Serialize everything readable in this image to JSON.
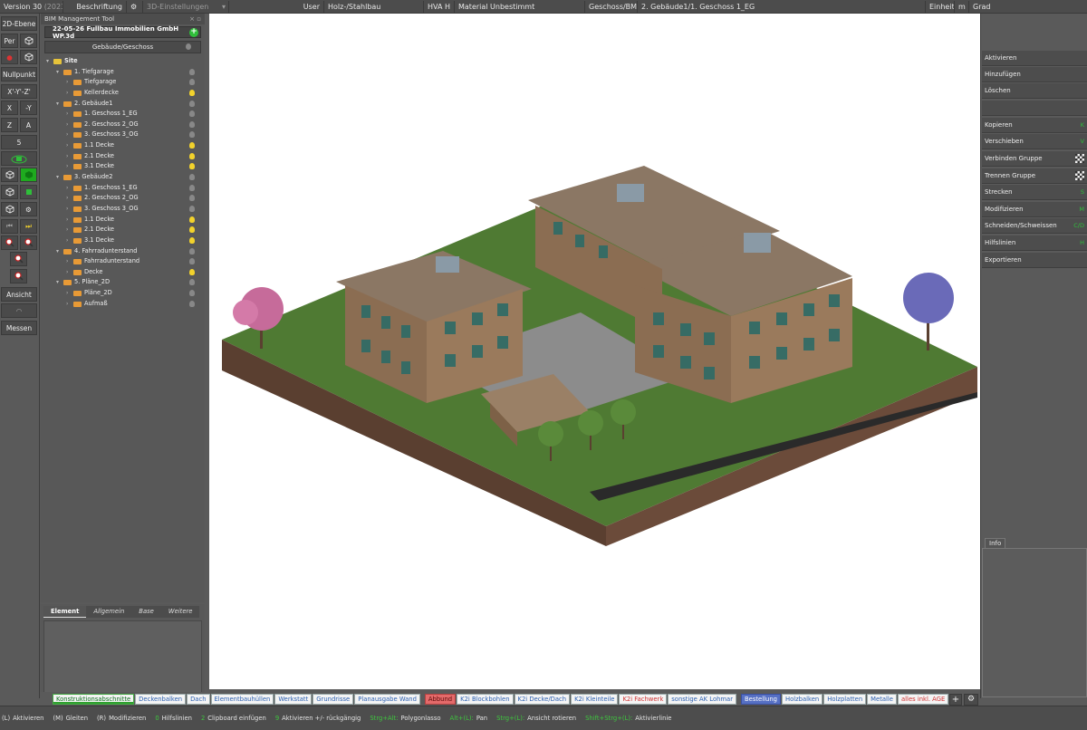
{
  "topbar": {
    "version": "Version 30",
    "version_year": "(2023)",
    "beschriftung": "Beschriftung",
    "einstellungen": "3D-Einstellungen",
    "user_label": "User",
    "user_value": "Holz-/Stahlbau",
    "hva": "HVA",
    "h": "H",
    "material_label": "Material",
    "material_value": "Unbestimmt",
    "geschoss_label": "Geschoss/BMT",
    "geschoss_value": "2. Gebäude1/1. Geschoss 1_EG",
    "einheit": "Einheit",
    "unit_m": "m",
    "unit_grad": "Grad"
  },
  "toolbar": {
    "ebene_2d": "2D-Ebene",
    "per": "Per",
    "nullpunkt": "Nullpunkt",
    "xyz": "X'-Y'-Z'",
    "x": "X",
    "neg_y": "-Y",
    "z": "Z",
    "a": "A",
    "five": "5",
    "ansicht": "Ansicht",
    "messen": "Messen"
  },
  "bim": {
    "title": "BIM Management Tool",
    "file": "22-05-26 Fullbau Immobilien GmbH WP.3d",
    "sub": "Gebäude/Geschoss",
    "tree": [
      {
        "label": "Site",
        "level": 0,
        "type": "site",
        "bulb": ""
      },
      {
        "label": "1. Tiefgarage",
        "level": 1,
        "type": "group",
        "bulb": "off"
      },
      {
        "label": "Tiefgarage",
        "level": 2,
        "type": "item",
        "bulb": "off"
      },
      {
        "label": "Kellerdecke",
        "level": 2,
        "type": "item",
        "bulb": "on"
      },
      {
        "label": "2. Gebäude1",
        "level": 1,
        "type": "group",
        "bulb": "off"
      },
      {
        "label": "1. Geschoss 1_EG",
        "level": 2,
        "type": "item",
        "bulb": "off"
      },
      {
        "label": "2. Geschoss 2_OG",
        "level": 2,
        "type": "item",
        "bulb": "off"
      },
      {
        "label": "3. Geschoss 3_OG",
        "level": 2,
        "type": "item",
        "bulb": "off"
      },
      {
        "label": "1.1 Decke",
        "level": 2,
        "type": "item",
        "bulb": "on"
      },
      {
        "label": "2.1 Decke",
        "level": 2,
        "type": "item",
        "bulb": "on"
      },
      {
        "label": "3.1 Decke",
        "level": 2,
        "type": "item",
        "bulb": "on"
      },
      {
        "label": "3. Gebäude2",
        "level": 1,
        "type": "group",
        "bulb": "off"
      },
      {
        "label": "1. Geschoss 1_EG",
        "level": 2,
        "type": "item",
        "bulb": "off"
      },
      {
        "label": "2. Geschoss 2_OG",
        "level": 2,
        "type": "item",
        "bulb": "off"
      },
      {
        "label": "3. Geschoss 3_OG",
        "level": 2,
        "type": "item",
        "bulb": "off"
      },
      {
        "label": "1.1 Decke",
        "level": 2,
        "type": "item",
        "bulb": "on"
      },
      {
        "label": "2.1 Decke",
        "level": 2,
        "type": "item",
        "bulb": "on"
      },
      {
        "label": "3.1 Decke",
        "level": 2,
        "type": "item",
        "bulb": "on"
      },
      {
        "label": "4. Fahrradunterstand",
        "level": 1,
        "type": "group",
        "bulb": "off"
      },
      {
        "label": "Fahrradunterstand",
        "level": 2,
        "type": "item",
        "bulb": "off"
      },
      {
        "label": "Decke",
        "level": 2,
        "type": "item",
        "bulb": "on"
      },
      {
        "label": "5. Pläne_2D",
        "level": 1,
        "type": "group",
        "bulb": "off"
      },
      {
        "label": "Pläne_2D",
        "level": 2,
        "type": "item",
        "bulb": "off"
      },
      {
        "label": "Aufmaß",
        "level": 2,
        "type": "item",
        "bulb": "off"
      }
    ]
  },
  "element_tabs": [
    "Element",
    "Allgemein",
    "Base",
    "Weitere"
  ],
  "right_panel": {
    "aktivieren": "Aktivieren",
    "hinzufuegen": "Hinzufügen",
    "loeschen": "Löschen",
    "kopieren": "Kopieren",
    "verschieben": "Verschieben",
    "verbinden": "Verbinden Gruppe",
    "trennen": "Trennen Gruppe",
    "strecken": "Strecken",
    "modifizieren": "Modifizieren",
    "schneiden": "Schneiden/Schweissen",
    "hilfslinien": "Hilfslinien",
    "exportieren": "Exportieren",
    "key_kopieren": "K",
    "key_verschieben": "V",
    "key_strecken": "S",
    "key_modifizieren": "M",
    "key_schneiden": "C/D",
    "key_hilfslinien": "H",
    "info": "Info"
  },
  "bottom_tabs": [
    {
      "label": "Konstruktionsabschnitte",
      "style": "green"
    },
    {
      "label": "Deckenbalken",
      "style": "normal"
    },
    {
      "label": "Dach",
      "style": "normal"
    },
    {
      "label": "Elementbauhüllen",
      "style": "normal"
    },
    {
      "label": "Werkstatt",
      "style": "normal"
    },
    {
      "label": "Grundrisse",
      "style": "normal"
    },
    {
      "label": "Planausgabe Wand",
      "style": "normal"
    },
    {
      "label": "Abbund",
      "style": "red"
    },
    {
      "label": "K2i Blockbohlen",
      "style": "normal"
    },
    {
      "label": "K2i Decke/Dach",
      "style": "normal"
    },
    {
      "label": "K2i Kleinteile",
      "style": "normal"
    },
    {
      "label": "K2i Fachwerk",
      "style": "redt"
    },
    {
      "label": "sonstige AK Lohmar",
      "style": "normal"
    },
    {
      "label": "Bestellung",
      "style": "blue"
    },
    {
      "label": "Holzbalken",
      "style": "normal"
    },
    {
      "label": "Holzplatten",
      "style": "normal"
    },
    {
      "label": "Metalle",
      "style": "normal"
    },
    {
      "label": "alles inkl. AGE",
      "style": "redt"
    }
  ],
  "status": [
    {
      "key": "(L)",
      "text": "Aktivieren"
    },
    {
      "key": "(M)",
      "text": "Gleiten"
    },
    {
      "key": "(R)",
      "text": "Modifizieren"
    },
    {
      "key": "0",
      "text": "Hilfslinien"
    },
    {
      "key": "2",
      "text": "Clipboard einfügen"
    },
    {
      "key": "9",
      "text": "Aktivieren +/- rückgängig"
    },
    {
      "key": "Strg+Alt:",
      "text": "Polygonlasso"
    },
    {
      "key": "Alt+(L):",
      "text": "Pan"
    },
    {
      "key": "Strg+(L):",
      "text": "Ansicht rotieren"
    },
    {
      "key": "Shift+Strg+(L):",
      "text": "Aktivierlinie"
    }
  ]
}
